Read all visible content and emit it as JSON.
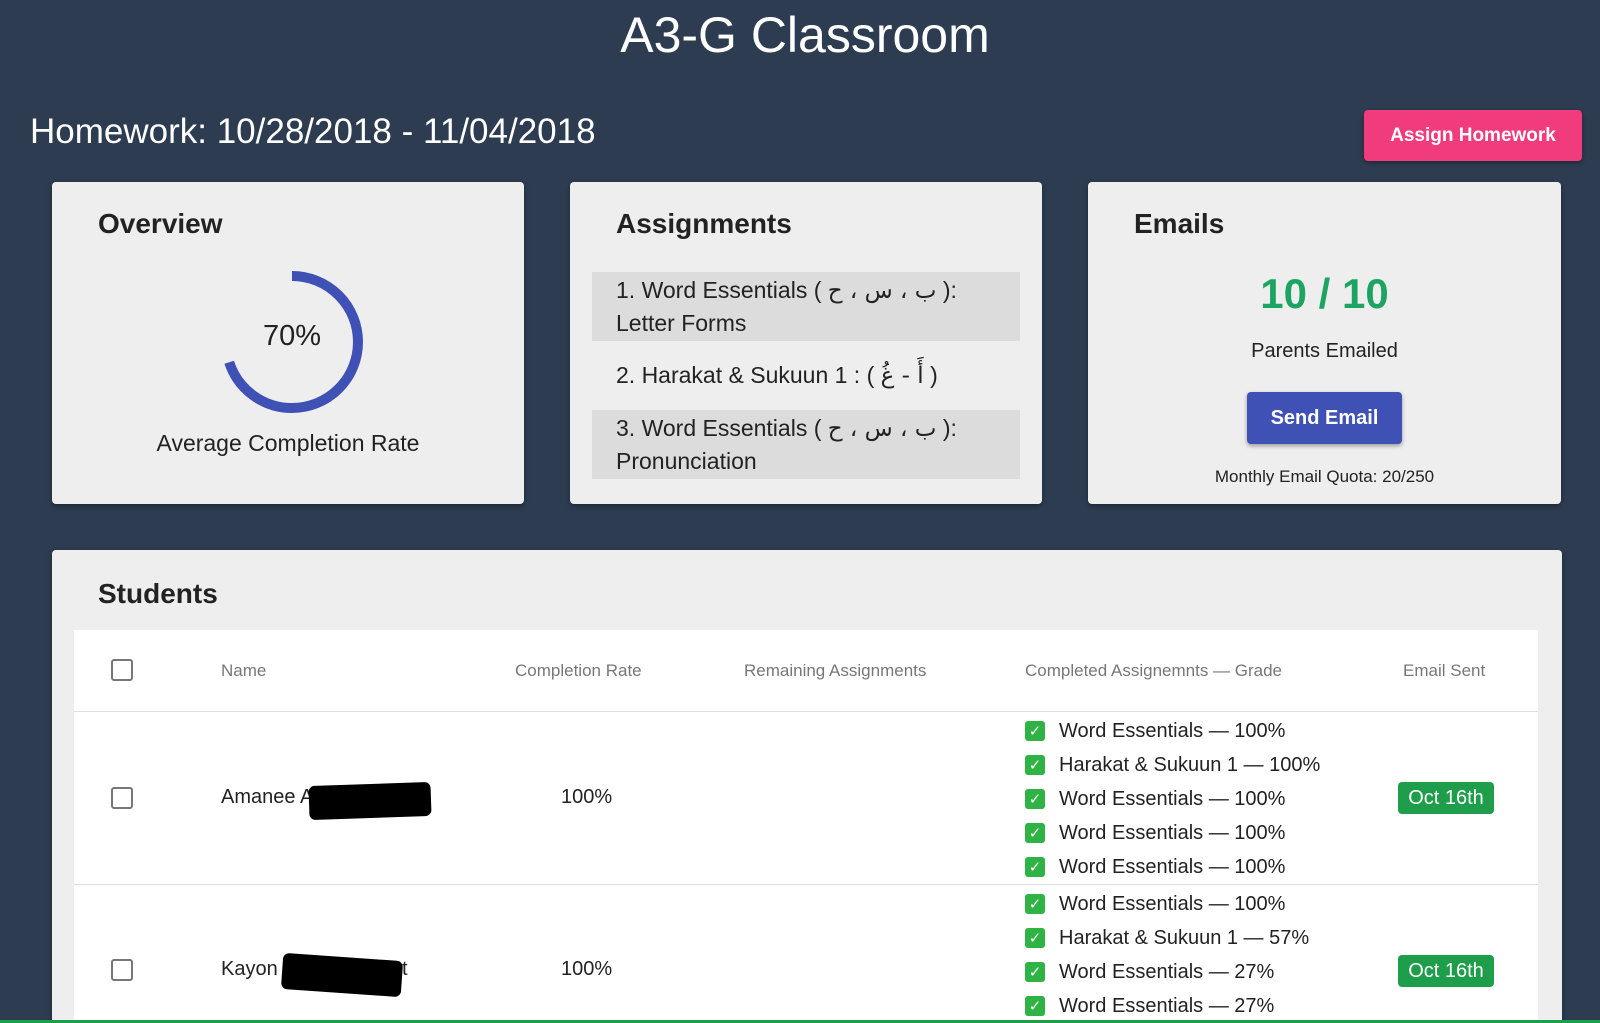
{
  "app": {
    "title": "A3-G Classroom"
  },
  "homework": {
    "range": "Homework: 10/28/2018 - 11/04/2018",
    "assign_label": "Assign Homework"
  },
  "overview": {
    "title": "Overview",
    "rate": 0.7,
    "rate_label": "70%",
    "caption": "Average Completion Rate",
    "color": "#3f51b5"
  },
  "assignments": {
    "title": "Assignments",
    "items": [
      {
        "prefix": "1. Word Essentials ( ",
        "arabic": "ب ، س ، ح",
        "suffix": " ):",
        "line2": "Letter Forms"
      },
      {
        "prefix": "2. Harakat & Sukuun 1 : ( ",
        "arabic": "أَ - غُ",
        "suffix": " )"
      },
      {
        "prefix": "3. Word Essentials ( ",
        "arabic": "ب ، س ، ح",
        "suffix": " ):",
        "line2": "Pronunciation"
      }
    ]
  },
  "emails": {
    "title": "Emails",
    "count": "10 / 10",
    "caption": "Parents Emailed",
    "send_label": "Send Email",
    "quota": "Monthly Email Quota: 20/250"
  },
  "students": {
    "title": "Students",
    "columns": {
      "name": "Name",
      "completion": "Completion Rate",
      "remaining": "Remaining Assignments",
      "completed": "Completed Assignemnts — Grade",
      "email": "Email Sent"
    },
    "rows": [
      {
        "name": "Amanee A",
        "completion": "100%",
        "email_sent": "Oct 16th",
        "grades": [
          "Word Essentials — 100%",
          "Harakat & Sukuun 1 — 100%",
          "Word Essentials — 100%",
          "Word Essentials — 100%",
          "Word Essentials — 100%"
        ]
      },
      {
        "name": "Kayon",
        "name_tail": "t",
        "completion": "100%",
        "email_sent": "Oct 16th",
        "grades": [
          "Word Essentials — 100%",
          "Harakat & Sukuun 1 — 57%",
          "Word Essentials — 27%",
          "Word Essentials — 27%"
        ]
      }
    ]
  },
  "icons": {
    "checkbox": "checkbox-icon",
    "check": "check-mark-icon"
  }
}
